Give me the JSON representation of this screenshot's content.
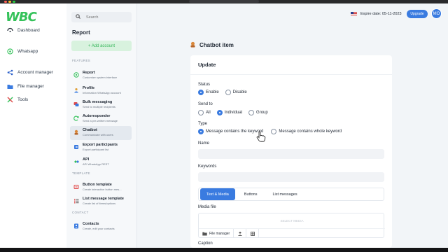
{
  "browser": {
    "traffic_lights": [
      "#ff5f57",
      "#febc2e",
      "#28c840"
    ]
  },
  "logo": {
    "text": "WBC",
    "color": "#35c25a"
  },
  "left_nav": {
    "items": [
      {
        "label": "Dashboard",
        "icon": "dashboard-icon"
      },
      {
        "label": "Whatsapp",
        "icon": "whatsapp-icon"
      },
      {
        "label": "Account manager",
        "icon": "share-icon"
      },
      {
        "label": "File manager",
        "icon": "folder-icon"
      },
      {
        "label": "Tools",
        "icon": "tools-icon"
      }
    ]
  },
  "panel": {
    "search_placeholder": "Search",
    "title": "Report",
    "add_button": "+ Add account",
    "sections": {
      "features": "FEATURES",
      "template": "TEMPLATE",
      "contact": "CONTACT"
    },
    "features": [
      {
        "title": "Report",
        "subtitle": "Customize system interface",
        "icon": "whatsapp-icon"
      },
      {
        "title": "Profile",
        "subtitle": "Information WhatsApp account",
        "icon": "profile-icon"
      },
      {
        "title": "Bulk messaging",
        "subtitle": "Send to multiple recipients",
        "icon": "bulk-message-icon"
      },
      {
        "title": "Autoresponder",
        "subtitle": "Send a pre-written message",
        "icon": "autoresponder-icon"
      },
      {
        "title": "Chatbot",
        "subtitle": "Communicate with users",
        "icon": "chatbot-icon"
      },
      {
        "title": "Export participants",
        "subtitle": "Export participant list",
        "icon": "export-icon"
      },
      {
        "title": "API",
        "subtitle": "API WhatsApp REST",
        "icon": "api-icon"
      }
    ],
    "templates": [
      {
        "title": "Button template",
        "subtitle": "Create interactive button mes...",
        "icon": "button-template-icon"
      },
      {
        "title": "List message template",
        "subtitle": "Create list of items/options",
        "icon": "list-template-icon"
      }
    ],
    "contacts": [
      {
        "title": "Contacts",
        "subtitle": "Create, edit your contacts",
        "icon": "contacts-icon"
      }
    ]
  },
  "header": {
    "expire": "Expire date: 05-11-2023",
    "upgrade": "Upgrade",
    "avatar": "MO"
  },
  "main": {
    "page_title": "Chatbot item",
    "card_title": "Update",
    "status": {
      "label": "Status",
      "options": [
        "Enable",
        "Disable"
      ],
      "selected": "Enable"
    },
    "send_to": {
      "label": "Send to",
      "options": [
        "All",
        "Individual",
        "Group"
      ],
      "selected": "Individual"
    },
    "type": {
      "label": "Type",
      "options": [
        "Message contains the keyword",
        "Message contains whole keyword"
      ],
      "selected": "Message contains the keyword"
    },
    "name": {
      "label": "Name",
      "value": ""
    },
    "keywords": {
      "label": "Keywords",
      "value": ""
    },
    "tabs": [
      "Text & Media",
      "Buttons",
      "List messages"
    ],
    "media": {
      "label": "Media file",
      "placeholder": "SELECT MEDIA",
      "file_manager": "File manager"
    },
    "caption": {
      "label": "Caption"
    }
  },
  "colors": {
    "accent": "#3a7be0",
    "brand_green": "#35c25a"
  }
}
